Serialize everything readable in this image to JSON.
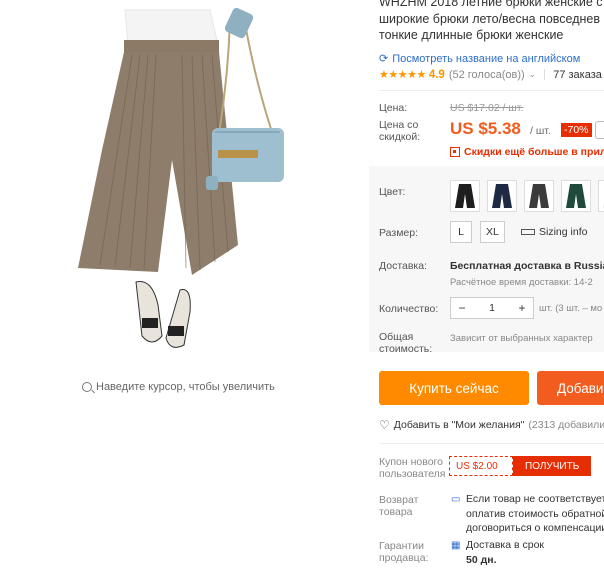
{
  "gallery": {
    "zoom_hint": "Наведите курсор, чтобы увеличить"
  },
  "product": {
    "title_lines": [
      "WHZHM 2018 летние брюки женские с",
      "широкие брюки лето/весна повседнев",
      "тонкие длинные брюки женские"
    ],
    "translate_link": "Посмотреть название на английском",
    "rating": "4.9",
    "votes": "(52 голоса(ов))",
    "orders": "77 заказа"
  },
  "price": {
    "label": "Цена:",
    "old": "US $17.02 / шт.",
    "discount_label": "Цена со скидкой:",
    "new": "US $5.38",
    "unit": "/ шт.",
    "discount": "-70%",
    "promo": "Скидки ещё больше в прило"
  },
  "options": {
    "color_label": "Цвет:",
    "size_label": "Размер:",
    "sizes": [
      "L",
      "XL"
    ],
    "sizing_info": "Sizing info",
    "shipping_label": "Доставка:",
    "shipping_value": "Бесплатная доставка в Russian",
    "shipping_time": "Расчётное время доставки: 14-2",
    "qty_label": "Количество:",
    "qty_minus": "−",
    "qty_value": "1",
    "qty_plus": "+",
    "qty_note": "шт. (3 шт. – мо",
    "total_label_1": "Общая",
    "total_label_2": "стоимость:",
    "total_value": "Зависит от выбранных характер"
  },
  "actions": {
    "buy_now": "Купить сейчас",
    "add_cart": "Добави",
    "wishlist": "Добавить в \"Мои желания\"",
    "wishlist_count": "(2313 добавили"
  },
  "coupon": {
    "label_1": "Купон нового",
    "label_2": "пользователя",
    "amount": "US $2.00",
    "get": "ПОЛУЧИТЬ"
  },
  "protection": {
    "return_label_1": "Возврат",
    "return_label_2": "товара",
    "return_lines": [
      "Если товар не соответствует",
      "оплатив стоимость обратной",
      "договориться о компенсации"
    ],
    "guarantee_label_1": "Гарантии",
    "guarantee_label_2": "продавца:",
    "guarantee_line_1": "Доставка в срок",
    "guarantee_line_2": "50 дн."
  },
  "colors": {
    "accent": "#f25c1e",
    "buy": "#ff8a00",
    "link": "#2d6ec8",
    "rating": "#ff9500"
  }
}
